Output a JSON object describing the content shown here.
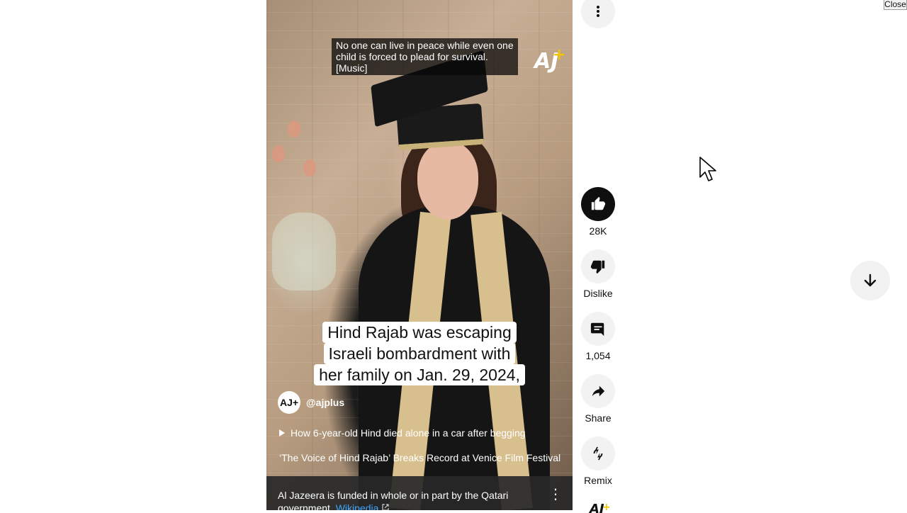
{
  "video": {
    "subtitle_lines": [
      "No one can live in peace while even one",
      "child is forced to plead for survival.",
      "[Music]"
    ],
    "caption_lines": [
      "Hind Rajab was escaping",
      "Israeli bombardment with",
      "her family on Jan. 29, 2024,"
    ],
    "brand_logo_text": "AJ+",
    "channel_handle": "@ajplus",
    "channel_avatar_text": "AJ+",
    "related_video": "How 6-year-old Hind died alone in a car after begging",
    "news_link": "‘The Voice of Hind Rajab’ Breaks Record at Venice Film Festival",
    "info_panel": {
      "text": "Al Jazeera is funded in whole or in part by the Qatari government.",
      "link_label": "Wikipedia"
    }
  },
  "actions": {
    "like_count": "28K",
    "dislike_label": "Dislike",
    "comment_count": "1,054",
    "share_label": "Share",
    "remix_label": "Remix"
  },
  "window": {
    "close_label": "Close"
  },
  "colors": {
    "accent_dark": "#0f0f0f",
    "button_bg": "#f2f2f2",
    "link_blue": "#3ea6ff"
  },
  "icons": [
    "more-vert-icon",
    "thumb-up-icon",
    "thumb-down-icon",
    "comment-icon",
    "share-icon",
    "remix-icon",
    "arrow-down-icon",
    "play-icon",
    "external-link-icon",
    "cursor-icon"
  ]
}
